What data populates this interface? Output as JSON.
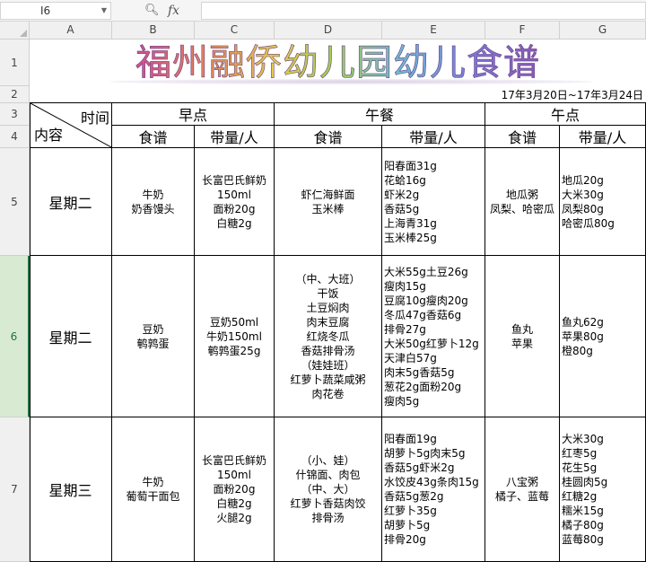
{
  "formula_bar": {
    "cell_ref": "I6",
    "fx_label": "fx",
    "formula": ""
  },
  "columns": [
    "A",
    "B",
    "C",
    "D",
    "E",
    "F",
    "G"
  ],
  "rows": [
    "1",
    "2",
    "3",
    "4",
    "5",
    "6",
    "7"
  ],
  "selected_row": "6",
  "sheet": {
    "title": "福州融侨幼儿园幼儿食谱",
    "date_range": "17年3月20日~17年3月24日",
    "corner_time": "时间",
    "corner_content": "内容",
    "groups": [
      "早点",
      "午餐",
      "午点"
    ],
    "subheaders": [
      "食谱",
      "带量/人",
      "食谱",
      "带量/人",
      "食谱",
      "带量/人"
    ],
    "entries": [
      {
        "day": "星期二",
        "breakfast_menu": [
          "牛奶",
          "奶香馒头"
        ],
        "breakfast_qty": [
          "长富巴氏鲜奶",
          "150ml",
          "面粉20g",
          "白糖2g"
        ],
        "lunch_menu": [
          "虾仁海鲜面",
          "玉米棒"
        ],
        "lunch_qty": [
          "阳春面31g",
          "花蛤16g",
          "虾米2g",
          "香菇5g",
          "上海青31g",
          "玉米棒25g"
        ],
        "snack_menu": [
          "地瓜粥",
          "凤梨、哈密瓜"
        ],
        "snack_qty": [
          "地瓜20g",
          "大米30g",
          "凤梨80g",
          "哈密瓜80g"
        ]
      },
      {
        "day": "星期二",
        "breakfast_menu": [
          "豆奶",
          "鹌鹑蛋"
        ],
        "breakfast_qty": [
          "豆奶50ml",
          "牛奶150ml",
          "鹌鹑蛋25g"
        ],
        "lunch_menu": [
          "（中、大班）",
          "干饭",
          "土豆焖肉",
          "肉末豆腐",
          "红烧冬瓜",
          "香菇排骨汤",
          "（娃娃班）",
          "红萝卜蔬菜咸粥",
          "肉花卷"
        ],
        "lunch_qty": [
          "大米55g土豆26g",
          "瘦肉15g",
          "豆腐10g瘦肉20g",
          "冬瓜47g香菇6g",
          "排骨27g",
          "大米50g红萝卜12g",
          "天津白57g",
          "肉末5g香菇5g",
          "葱花2g面粉20g",
          "瘦肉5g"
        ],
        "snack_menu": [
          "鱼丸",
          "苹果"
        ],
        "snack_qty": [
          "鱼丸62g",
          "苹果80g",
          "橙80g"
        ]
      },
      {
        "day": "星期三",
        "breakfast_menu": [
          "牛奶",
          "葡萄干面包"
        ],
        "breakfast_qty": [
          "长富巴氏鲜奶",
          "150ml",
          "面粉20g",
          "白糖2g",
          "火腿2g"
        ],
        "lunch_menu": [
          "（小、娃）",
          "什锦面、肉包",
          "（中、大）",
          "红萝卜香菇肉饺",
          "排骨汤"
        ],
        "lunch_qty": [
          "阳春面19g",
          "胡萝卜5g肉末5g",
          "香菇5g虾米2g",
          "水饺皮43g条肉15g",
          "香菇5g葱2g",
          "红萝卜35g",
          "胡萝卜5g",
          "排骨20g"
        ],
        "snack_menu": [
          "八宝粥",
          "橘子、蓝莓"
        ],
        "snack_qty": [
          "大米30g",
          "红枣5g",
          "花生5g",
          "桂圆肉5g",
          "红糖2g",
          "糯米15g",
          "橘子80g",
          "蓝莓80g"
        ]
      }
    ]
  }
}
